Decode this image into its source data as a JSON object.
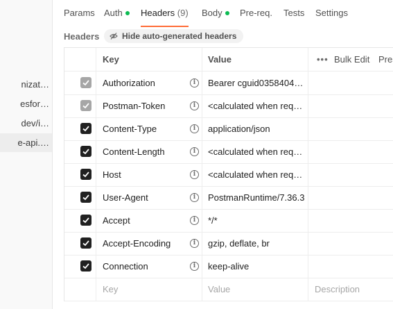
{
  "sidebar": {
    "items": [
      {
        "label": "nizat…"
      },
      {
        "label": "esfor…"
      },
      {
        "label": "dev/i…"
      },
      {
        "label": "e-api.…"
      }
    ]
  },
  "tabs": [
    {
      "label": "Params"
    },
    {
      "label": "Auth"
    },
    {
      "label": "Headers",
      "count": "(9)"
    },
    {
      "label": "Body"
    },
    {
      "label": "Pre-req."
    },
    {
      "label": "Tests"
    },
    {
      "label": "Settings"
    }
  ],
  "headers_section": {
    "title": "Headers",
    "hide_button": "Hide auto-generated headers"
  },
  "table": {
    "columns": {
      "key": "Key",
      "value": "Value",
      "more": "•••",
      "bulk_edit": "Bulk Edit",
      "presets": "Pres"
    },
    "rows": [
      {
        "key": "Authorization",
        "value": "Bearer cguid0358404…"
      },
      {
        "key": "Postman-Token",
        "value": "<calculated when requ…"
      },
      {
        "key": "Content-Type",
        "value": "application/json"
      },
      {
        "key": "Content-Length",
        "value": "<calculated when requ…"
      },
      {
        "key": "Host",
        "value": "<calculated when requ…"
      },
      {
        "key": "User-Agent",
        "value": "PostmanRuntime/7.36.3"
      },
      {
        "key": "Accept",
        "value": "*/*"
      },
      {
        "key": "Accept-Encoding",
        "value": "gzip, deflate, br"
      },
      {
        "key": "Connection",
        "value": "keep-alive"
      }
    ],
    "new_row": {
      "key_placeholder": "Key",
      "value_placeholder": "Value",
      "description_placeholder": "Description"
    }
  },
  "colors": {
    "accent": "#ff6c37",
    "status_dot": "#0cbb52"
  }
}
